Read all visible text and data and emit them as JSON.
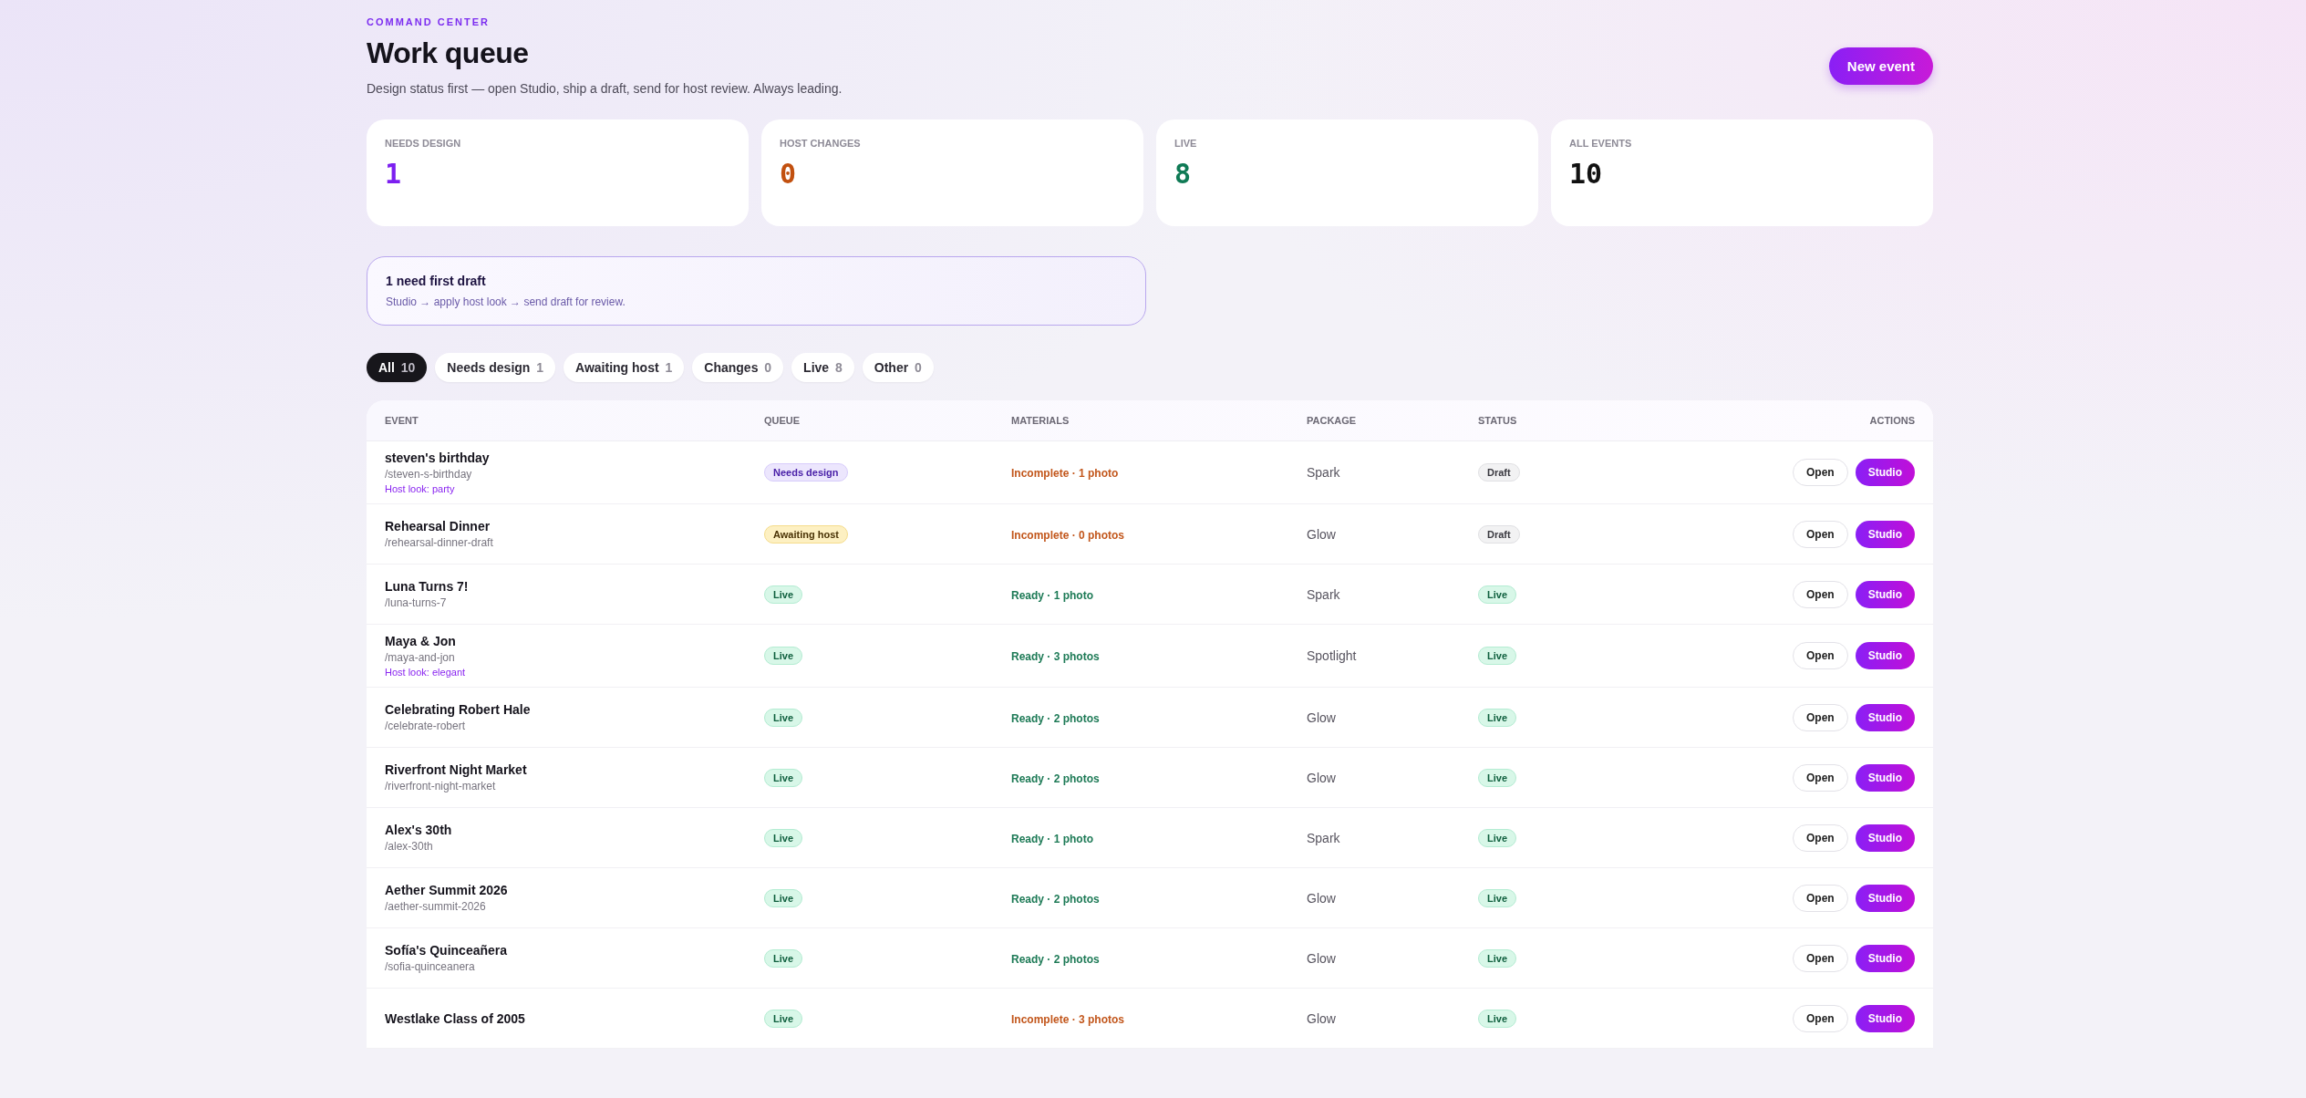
{
  "header": {
    "eyebrow": "COMMAND CENTER",
    "title": "Work queue",
    "subtitle": "Design status first — open Studio, ship a draft, send for host review. Always leading.",
    "action": "New event"
  },
  "stats": [
    {
      "label": "NEEDS DESIGN",
      "value": "1",
      "color": "#7c1ff0"
    },
    {
      "label": "HOST CHANGES",
      "value": "0",
      "color": "#c2500f"
    },
    {
      "label": "LIVE",
      "value": "8",
      "color": "#0f7a55"
    },
    {
      "label": "ALL EVENTS",
      "value": "10",
      "color": "#111111"
    }
  ],
  "banner": {
    "title": "1 need first draft",
    "text": "Studio → apply host look → send draft for review."
  },
  "filters": [
    {
      "label": "All",
      "count": "10",
      "selected": true
    },
    {
      "label": "Needs design",
      "count": "1",
      "selected": false
    },
    {
      "label": "Awaiting host",
      "count": "1",
      "selected": false
    },
    {
      "label": "Changes",
      "count": "0",
      "selected": false
    },
    {
      "label": "Live",
      "count": "8",
      "selected": false
    },
    {
      "label": "Other",
      "count": "0",
      "selected": false
    }
  ],
  "table": {
    "columns": [
      "EVENT",
      "QUEUE",
      "MATERIALS",
      "PACKAGE",
      "STATUS",
      "ACTIONS"
    ],
    "rows": [
      {
        "name": "steven's birthday",
        "slug": "/steven-s-birthday",
        "look": "Host look: party",
        "queue": {
          "kind": "design",
          "label": "Needs design"
        },
        "materials": {
          "ready": false,
          "text": "Incomplete · 1 photo"
        },
        "package": "Spark",
        "status": {
          "kind": "draft",
          "label": "Draft"
        },
        "open": "Open",
        "studio": "Studio"
      },
      {
        "name": "Rehearsal Dinner",
        "slug": "/rehearsal-dinner-draft",
        "queue": {
          "kind": "awaiting",
          "label": "Awaiting host"
        },
        "materials": {
          "ready": false,
          "text": "Incomplete · 0 photos"
        },
        "package": "Glow",
        "status": {
          "kind": "draft",
          "label": "Draft"
        },
        "open": "Open",
        "studio": "Studio"
      },
      {
        "name": "Luna Turns 7!",
        "slug": "/luna-turns-7",
        "queue": {
          "kind": "live",
          "label": "Live"
        },
        "materials": {
          "ready": true,
          "text": "Ready · 1 photo"
        },
        "package": "Spark",
        "status": {
          "kind": "live",
          "label": "Live"
        },
        "open": "Open",
        "studio": "Studio"
      },
      {
        "name": "Maya & Jon",
        "slug": "/maya-and-jon",
        "look": "Host look: elegant",
        "queue": {
          "kind": "live",
          "label": "Live"
        },
        "materials": {
          "ready": true,
          "text": "Ready · 3 photos"
        },
        "package": "Spotlight",
        "status": {
          "kind": "live",
          "label": "Live"
        },
        "open": "Open",
        "studio": "Studio"
      },
      {
        "name": "Celebrating Robert Hale",
        "slug": "/celebrate-robert",
        "queue": {
          "kind": "live",
          "label": "Live"
        },
        "materials": {
          "ready": true,
          "text": "Ready · 2 photos"
        },
        "package": "Glow",
        "status": {
          "kind": "live",
          "label": "Live"
        },
        "open": "Open",
        "studio": "Studio"
      },
      {
        "name": "Riverfront Night Market",
        "slug": "/riverfront-night-market",
        "queue": {
          "kind": "live",
          "label": "Live"
        },
        "materials": {
          "ready": true,
          "text": "Ready · 2 photos"
        },
        "package": "Glow",
        "status": {
          "kind": "live",
          "label": "Live"
        },
        "open": "Open",
        "studio": "Studio"
      },
      {
        "name": "Alex's 30th",
        "slug": "/alex-30th",
        "queue": {
          "kind": "live",
          "label": "Live"
        },
        "materials": {
          "ready": true,
          "text": "Ready · 1 photo"
        },
        "package": "Spark",
        "status": {
          "kind": "live",
          "label": "Live"
        },
        "open": "Open",
        "studio": "Studio"
      },
      {
        "name": "Aether Summit 2026",
        "slug": "/aether-summit-2026",
        "queue": {
          "kind": "live",
          "label": "Live"
        },
        "materials": {
          "ready": true,
          "text": "Ready · 2 photos"
        },
        "package": "Glow",
        "status": {
          "kind": "live",
          "label": "Live"
        },
        "open": "Open",
        "studio": "Studio"
      },
      {
        "name": "Sofía's Quinceañera",
        "slug": "/sofia-quinceanera",
        "queue": {
          "kind": "live",
          "label": "Live"
        },
        "materials": {
          "ready": true,
          "text": "Ready · 2 photos"
        },
        "package": "Glow",
        "status": {
          "kind": "live",
          "label": "Live"
        },
        "open": "Open",
        "studio": "Studio"
      },
      {
        "name": "Westlake Class of 2005",
        "queue": {
          "kind": "live",
          "label": "Live"
        },
        "materials": {
          "ready": false,
          "text": "Incomplete · 3 photos"
        },
        "package": "Glow",
        "status": {
          "kind": "live",
          "label": "Live"
        },
        "open": "Open",
        "studio": "Studio"
      }
    ]
  }
}
